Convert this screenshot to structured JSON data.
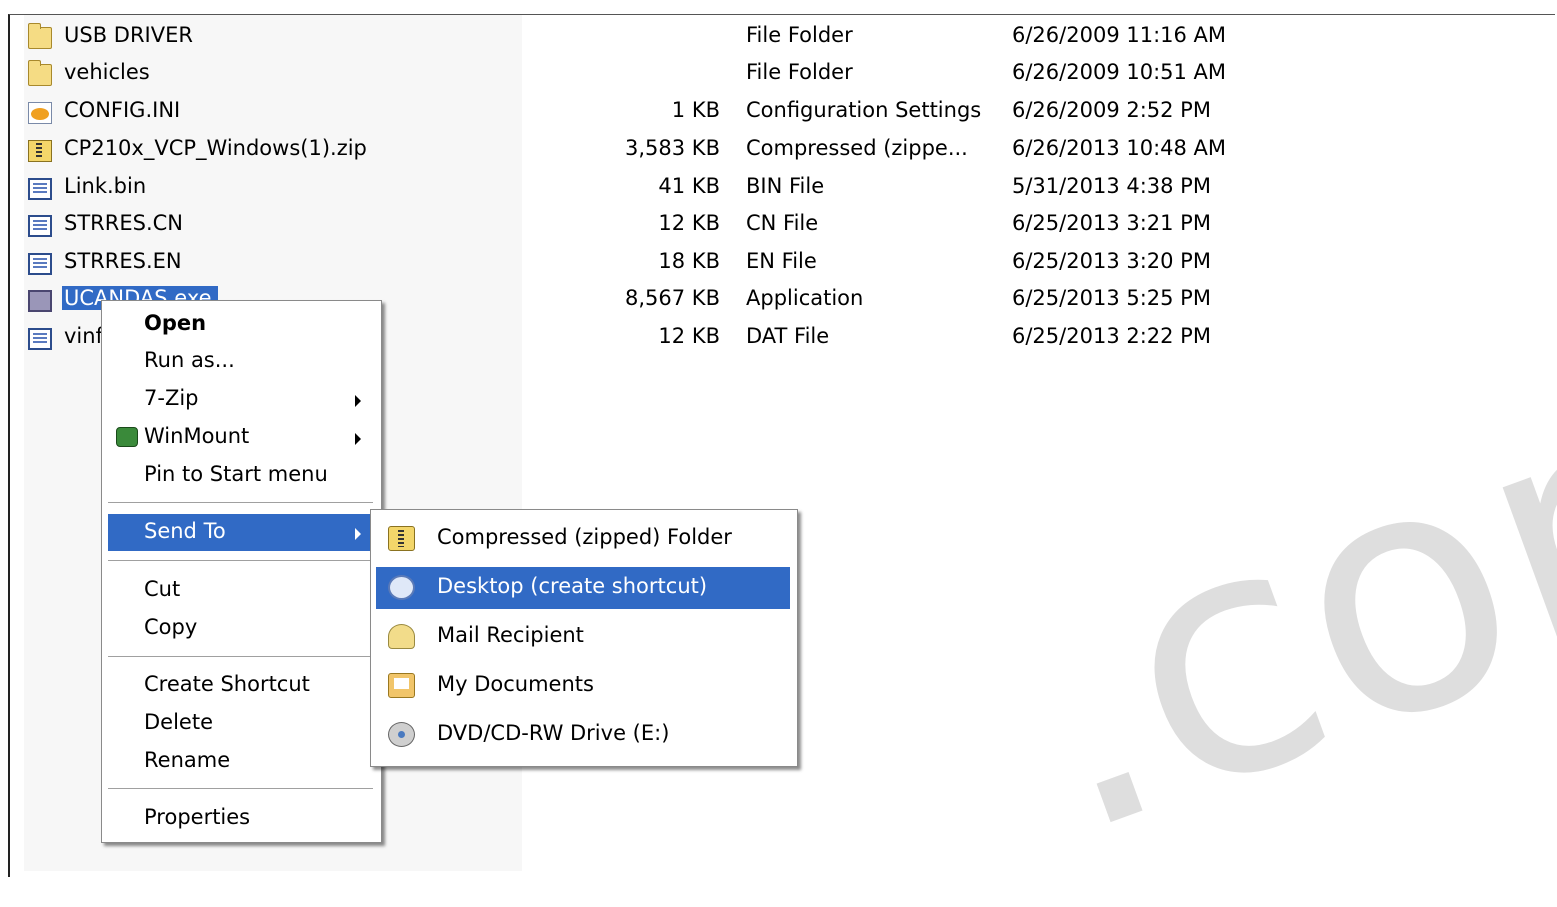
{
  "files": [
    {
      "icon": "folder-icon",
      "name": "USB DRIVER",
      "size": "",
      "type": "File Folder",
      "date": "6/26/2009 11:16 AM"
    },
    {
      "icon": "folder-icon",
      "name": "vehicles",
      "size": "",
      "type": "File Folder",
      "date": "6/26/2009 10:51 AM"
    },
    {
      "icon": "config-settings-icon",
      "name": "CONFIG.INI",
      "size": "1 KB",
      "type": "Configuration Settings",
      "date": "6/26/2009 2:52 PM"
    },
    {
      "icon": "zip-folder-icon",
      "name": "CP210x_VCP_Windows(1).zip",
      "size": "3,583 KB",
      "type": "Compressed (zippe...",
      "date": "6/26/2013 10:48 AM"
    },
    {
      "icon": "bin-file-icon",
      "name": "Link.bin",
      "size": "41 KB",
      "type": "BIN File",
      "date": "5/31/2013 4:38 PM"
    },
    {
      "icon": "generic-file-icon",
      "name": "STRRES.CN",
      "size": "12 KB",
      "type": "CN File",
      "date": "6/25/2013 3:21 PM"
    },
    {
      "icon": "generic-file-icon",
      "name": "STRRES.EN",
      "size": "18 KB",
      "type": "EN File",
      "date": "6/25/2013 3:20 PM"
    },
    {
      "icon": "application-icon",
      "name": "UCANDAS.exe",
      "size": "8,567 KB",
      "type": "Application",
      "date": "6/25/2013 5:25 PM"
    },
    {
      "icon": "generic-file-icon",
      "name": "vinf",
      "size": "12 KB",
      "type": "DAT File",
      "date": "6/25/2013 2:22 PM"
    }
  ],
  "context_menu": {
    "open": "Open",
    "run_as": "Run as...",
    "seven_zip": "7-Zip",
    "winmount": "WinMount",
    "pin_start": "Pin to Start menu",
    "send_to": "Send To",
    "cut": "Cut",
    "copy": "Copy",
    "create_shortcut": "Create Shortcut",
    "delete": "Delete",
    "rename": "Rename",
    "properties": "Properties"
  },
  "send_to_menu": {
    "compressed": "Compressed (zipped) Folder",
    "desktop": "Desktop (create shortcut)",
    "mail": "Mail Recipient",
    "my_documents": "My Documents",
    "dvd": "DVD/CD-RW Drive (E:)"
  },
  "watermark": ".com",
  "colors": {
    "selection": "#316ac5",
    "name_column_bg": "#f7f7f7"
  }
}
